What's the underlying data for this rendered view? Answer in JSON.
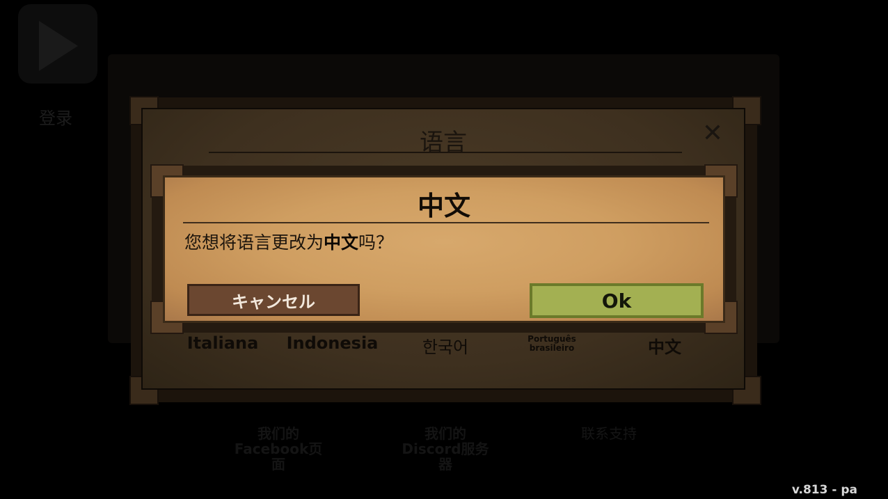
{
  "background": {
    "login_label": "登录",
    "links": [
      {
        "label": "我们的Facebook页面"
      },
      {
        "label": "我们的Discord服务器"
      },
      {
        "label": "联系支持"
      }
    ]
  },
  "language_panel": {
    "title": "语言",
    "options": [
      {
        "label": "Italiana"
      },
      {
        "label": "Indonesia"
      },
      {
        "label": "한국어"
      },
      {
        "label": "Português brasileiro"
      },
      {
        "label": "中文"
      }
    ]
  },
  "confirm_dialog": {
    "title": "中文",
    "message_prefix": "您想将语言更改为",
    "message_lang": "中文",
    "message_suffix": "吗？",
    "cancel_label": "キャンセル",
    "ok_label": "Ok"
  },
  "version": "v.813 - pa",
  "colors": {
    "dialog_bg": "#d2a365",
    "ok_button": "#a3b052",
    "cancel_button": "#6b4730"
  }
}
